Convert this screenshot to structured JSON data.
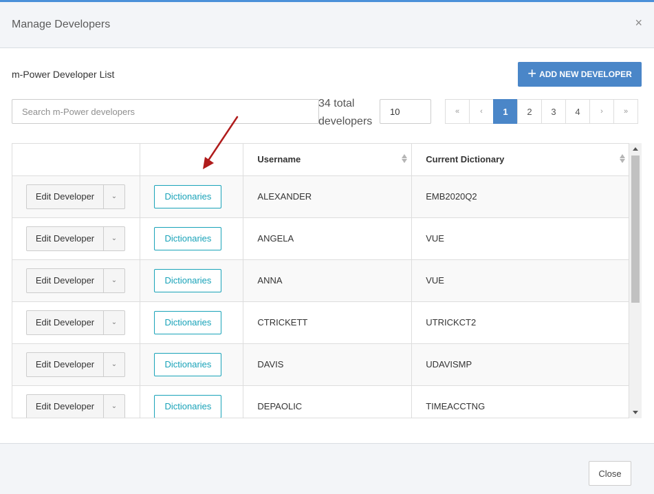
{
  "modal": {
    "title": "Manage Developers",
    "close_icon": "close-icon",
    "close_glyph": "×"
  },
  "list_title": "m-Power Developer List",
  "add_button": {
    "label": "ADD NEW DEVELOPER",
    "icon": "plus-icon",
    "glyph": "+"
  },
  "search": {
    "placeholder": "Search m-Power developers",
    "value": ""
  },
  "total_text": "34 total developers",
  "page_size": "10",
  "pagination": {
    "first": "«",
    "prev": "‹",
    "next": "›",
    "last": "»",
    "pages": [
      "1",
      "2",
      "3",
      "4"
    ],
    "current": "1"
  },
  "table": {
    "headers": [
      "",
      "",
      "Username",
      "Current Dictionary"
    ],
    "edit_label": "Edit Developer",
    "dict_label": "Dictionaries",
    "rows": [
      {
        "username": "ALEXANDER",
        "dictionary": "EMB2020Q2"
      },
      {
        "username": "ANGELA",
        "dictionary": "VUE"
      },
      {
        "username": "ANNA",
        "dictionary": "VUE"
      },
      {
        "username": "CTRICKETT",
        "dictionary": "UTRICKCT2"
      },
      {
        "username": "DAVIS",
        "dictionary": "UDAVISMP"
      },
      {
        "username": "DEPAOLIC",
        "dictionary": "TIMEACCTNG"
      }
    ]
  },
  "footer": {
    "close_label": "Close"
  },
  "colors": {
    "accent": "#4a86c8",
    "dict_button": "#17a2b8",
    "annotation_arrow": "#b01c1c"
  }
}
